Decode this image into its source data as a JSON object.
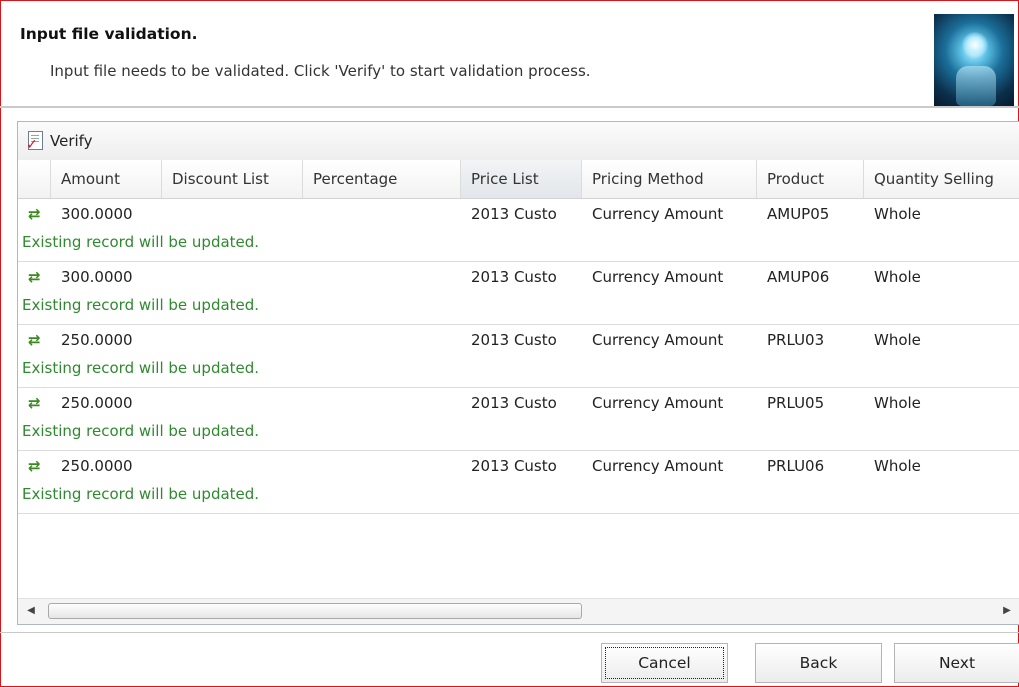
{
  "header": {
    "title": "Input file validation.",
    "subtitle": "Input file needs to be validated. Click 'Verify' to start validation process."
  },
  "toolbar": {
    "verify_label": "Verify"
  },
  "grid": {
    "columns": [
      "Amount",
      "Discount List",
      "Percentage",
      "Price List",
      "Pricing Method",
      "Product",
      "Quantity Selling"
    ],
    "active_column": "Price List",
    "rows": [
      {
        "amount": "300.0000",
        "discount_list": "",
        "percentage": "",
        "price_list": "2013 Custo",
        "pricing_method": "Currency Amount",
        "product": "AMUP05",
        "quantity_selling": "Whole",
        "message": "Existing record will be updated."
      },
      {
        "amount": "300.0000",
        "discount_list": "",
        "percentage": "",
        "price_list": "2013 Custo",
        "pricing_method": "Currency Amount",
        "product": "AMUP06",
        "quantity_selling": "Whole",
        "message": "Existing record will be updated."
      },
      {
        "amount": "250.0000",
        "discount_list": "",
        "percentage": "",
        "price_list": "2013 Custo",
        "pricing_method": "Currency Amount",
        "product": "PRLU03",
        "quantity_selling": "Whole",
        "message": "Existing record will be updated."
      },
      {
        "amount": "250.0000",
        "discount_list": "",
        "percentage": "",
        "price_list": "2013 Custo",
        "pricing_method": "Currency Amount",
        "product": "PRLU05",
        "quantity_selling": "Whole",
        "message": "Existing record will be updated."
      },
      {
        "amount": "250.0000",
        "discount_list": "",
        "percentage": "",
        "price_list": "2013 Custo",
        "pricing_method": "Currency Amount",
        "product": "PRLU06",
        "quantity_selling": "Whole",
        "message": "Existing record will be updated."
      }
    ]
  },
  "buttons": {
    "cancel": "Cancel",
    "back": "Back",
    "next": "Next"
  },
  "icons": {
    "verify": "verify-document-icon",
    "row_status": "update-arrows-icon",
    "header_image": "hand-light-image"
  },
  "colors": {
    "message": "#2f8a2f",
    "row_icon": "#3a8a1f",
    "frame_border": "#d9141b"
  }
}
